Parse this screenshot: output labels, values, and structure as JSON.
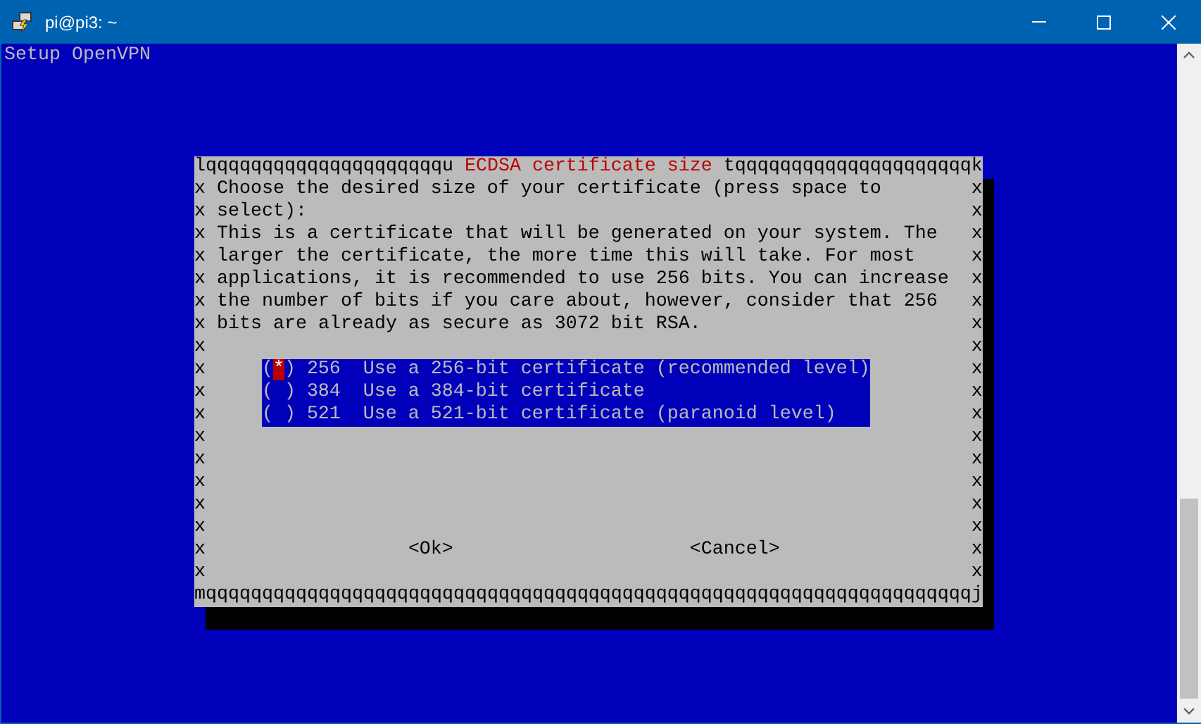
{
  "window": {
    "title": "pi@pi3: ~"
  },
  "terminal": {
    "header": "Setup OpenVPN"
  },
  "dialog": {
    "border_top_left": "lqqqqqqqqqqqqqqqqqqqqqu",
    "title": "ECDSA certificate size",
    "border_top_right": "tqqqqqqqqqqqqqqqqqqqqqk",
    "border_left": "xxxxxxxxxxxxxxxxxx",
    "border_right": "xxxxxxxxxxxxxxxxxx",
    "border_bottom": "mqqqqqqqqqqqqqqqqqqqqqqqqqqqqqqqqqqqqqqqqqqqqqqqqqqqqqqqqqqqqqqqqqqqqj",
    "paragraphs": [
      "Choose the desired size of your certificate (press space to select):",
      "This is a certificate that will be generated on your system. The larger the certificate, the more time this will take. For most applications, it is recommended to use 256 bits. You can increase the number of bits if you care about, however, consider that 256 bits are already as secure as 3072 bit RSA."
    ],
    "radio_open": "(",
    "radio_mark": "*",
    "radio_close": ")",
    "options": [
      {
        "tag": "256",
        "description": "Use a 256-bit certificate (recommended level)",
        "selected": true,
        "focused": true
      },
      {
        "tag": "384",
        "description": "Use a 384-bit certificate",
        "selected": false,
        "focused": false
      },
      {
        "tag": "521",
        "description": "Use a 521-bit certificate (paranoid level)",
        "selected": false,
        "focused": false
      }
    ],
    "buttons": [
      "<Ok>",
      "<Cancel>"
    ]
  }
}
